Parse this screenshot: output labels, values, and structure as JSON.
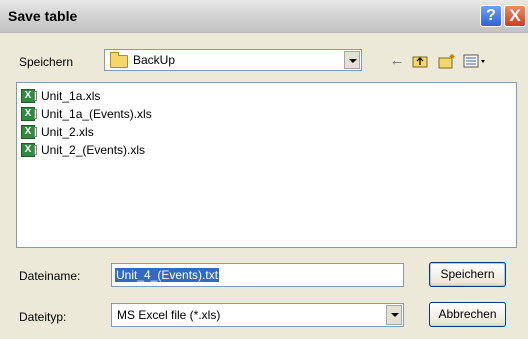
{
  "window": {
    "title": "Save table"
  },
  "titlebar": {
    "help_label": "?",
    "close_label": "X"
  },
  "look_in": {
    "label": "Speichern",
    "value": "BackUp"
  },
  "toolbar": {
    "back_icon": "arrow-left-icon",
    "up_icon": "up-folder-icon",
    "new_folder_icon": "new-folder-icon",
    "views_icon": "views-menu-icon"
  },
  "files": [
    {
      "name": "Unit_1a.xls"
    },
    {
      "name": "Unit_1a_(Events).xls"
    },
    {
      "name": "Unit_2.xls"
    },
    {
      "name": "Unit_2_(Events).xls"
    }
  ],
  "filename": {
    "label": "Dateiname:",
    "value": "Unit_4_(Events).txt"
  },
  "filetype": {
    "label": "Dateityp:",
    "value": "MS Excel file (*.xls)"
  },
  "buttons": {
    "save": "Speichern",
    "cancel": "Abbrechen"
  },
  "colors": {
    "dialog_bg": "#ece9d8",
    "selection": "#316ac5",
    "border": "#7f9db9"
  }
}
